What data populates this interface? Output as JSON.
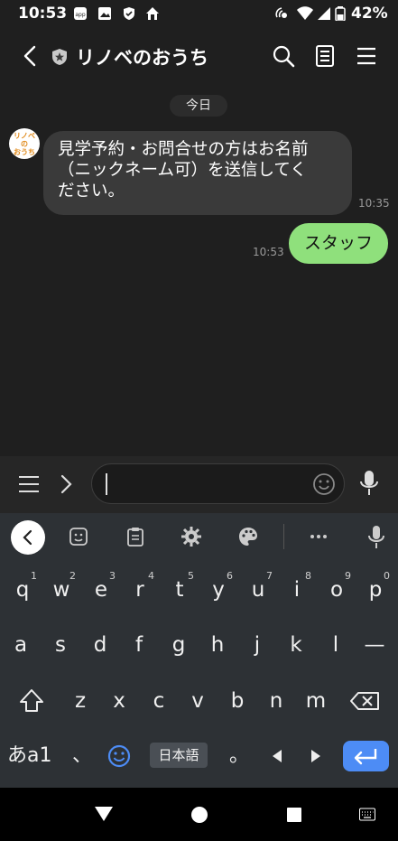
{
  "status_bar": {
    "time": "10:53",
    "battery_percent": "42%"
  },
  "header": {
    "title": "リノベのおうち"
  },
  "chat": {
    "date_label": "今日",
    "avatar_text": "リノベのおうち",
    "incoming": {
      "text_line1": "見学予約・お問合せの方はお名前",
      "text_line2": "（ニックネーム可）を送信してく",
      "text_line3": "ださい。",
      "time": "10:35"
    },
    "outgoing": {
      "text": "スタッフ",
      "time": "10:53"
    }
  },
  "input": {
    "placeholder": ""
  },
  "keyboard": {
    "row1": [
      {
        "key": "q",
        "num": "1"
      },
      {
        "key": "w",
        "num": "2"
      },
      {
        "key": "e",
        "num": "3"
      },
      {
        "key": "r",
        "num": "4"
      },
      {
        "key": "t",
        "num": "5"
      },
      {
        "key": "y",
        "num": "6"
      },
      {
        "key": "u",
        "num": "7"
      },
      {
        "key": "i",
        "num": "8"
      },
      {
        "key": "o",
        "num": "9"
      },
      {
        "key": "p",
        "num": "0"
      }
    ],
    "row2": [
      "a",
      "s",
      "d",
      "f",
      "g",
      "h",
      "j",
      "k",
      "l",
      "—"
    ],
    "row3": [
      "z",
      "x",
      "c",
      "v",
      "b",
      "n",
      "m"
    ],
    "bottom": {
      "mode_key": "あa1",
      "comma": "、",
      "language": "日本語",
      "period": "。"
    }
  },
  "colors": {
    "accent": "#4d8cf5",
    "outgoing_bubble": "#8fe07c",
    "incoming_bubble": "#3a3a3a",
    "keyboard_bg": "#2d3135"
  }
}
